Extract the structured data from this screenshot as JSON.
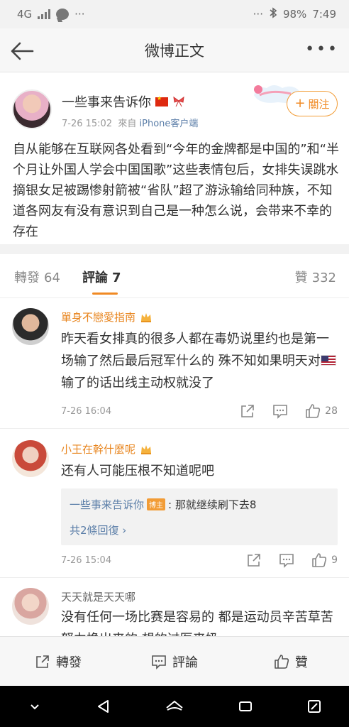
{
  "status_bar": {
    "network": "4G",
    "dots_left": "···",
    "dots_right": "···",
    "battery": "98%",
    "time": "7:49"
  },
  "header": {
    "title": "微博正文"
  },
  "post": {
    "author": "一些事来告诉你",
    "time": "7-26 15:02",
    "source_prefix": "來自",
    "source": "iPhone客户端",
    "follow_label": "關注",
    "text": "自从能够在互联网各处看到“今年的金牌都是中国的”和“半个月让外国人学会中国国歌”这些表情包后，女排失误跳水摘银女足被踢惨射箭被“省队”超了游泳输给同种族，不知道各网友有没有意识到自己是一种怎么说，会带来不幸的存在"
  },
  "tabs": {
    "forward": {
      "label": "轉發",
      "count": "64"
    },
    "comments": {
      "label": "評論",
      "count": "7"
    },
    "likes": {
      "label": "贊",
      "count": "332"
    }
  },
  "comments": [
    {
      "user": "單身不戀愛指南",
      "text_before_flag": "昨天看女排真的很多人都在毒奶说里约也是第一场输了然后最后冠军什么的 殊不知如果明天对",
      "text_after_flag": "输了的话出线主动权就没了",
      "time": "7-26 16:04",
      "likes": "28"
    },
    {
      "user": "小王在幹什麼呢",
      "text": "还有人可能压根不知道呢吧",
      "reply": {
        "author": "一些事来告诉你",
        "badge": "博主",
        "text": ": 那就继续刷下去8",
        "more": "共2條回復 ›"
      },
      "time": "7-26 15:04",
      "likes": "9"
    },
    {
      "user": "天天就是天天哪",
      "text": "没有任何一场比赛是容易的 都是运动员辛苦草苦努力换出来的 想的过医来奶"
    }
  ],
  "bottom_bar": {
    "forward": "轉發",
    "comment": "評論",
    "like": "贊"
  },
  "colors": {
    "accent": "#f08a24",
    "link": "#5b7ea8"
  }
}
